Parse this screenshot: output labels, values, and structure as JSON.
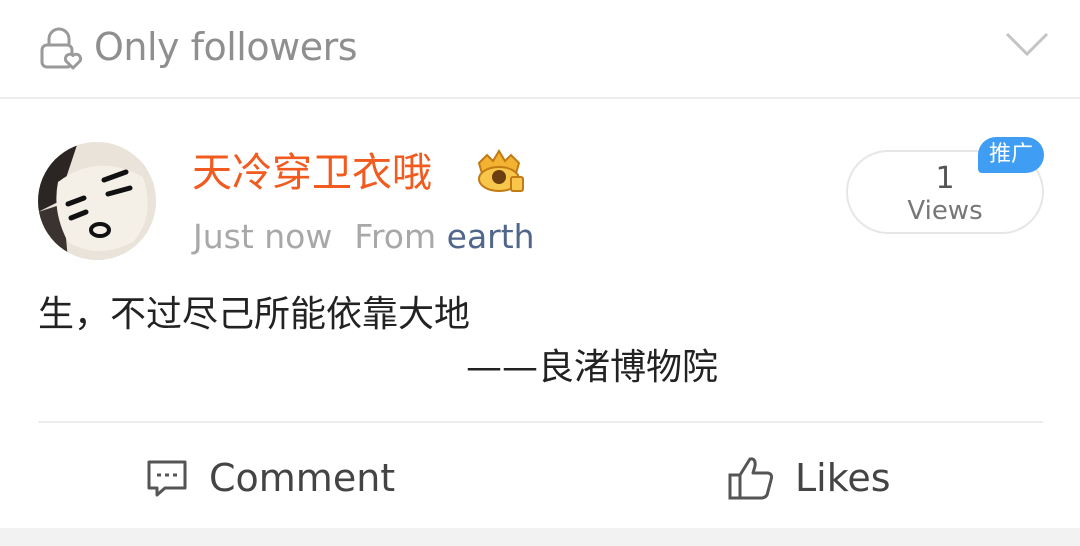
{
  "visibility": {
    "label": "Only followers",
    "icon": "lock-heart-icon",
    "chevron_icon": "chevron-down-icon"
  },
  "post": {
    "author": {
      "name": "天冷穿卫衣哦",
      "avatar_icon": "cartoon-face-avatar",
      "badge_icon": "crown-badge-icon"
    },
    "time": "Just now",
    "from_prefix": "From",
    "location": "earth",
    "views": {
      "count": "1",
      "label": "Views",
      "promo_tag": "推广"
    },
    "content": {
      "line1": "生，不过尽己所能依靠大地",
      "line2": "——良渚博物院"
    }
  },
  "actions": {
    "comment_label": "Comment",
    "comment_icon": "comment-icon",
    "like_label": "Likes",
    "like_icon": "thumbs-up-icon"
  },
  "colors": {
    "username": "#f15b1f",
    "location": "#50678b",
    "promo_bg": "#3f9df3",
    "muted_text": "#a8a8a8"
  }
}
